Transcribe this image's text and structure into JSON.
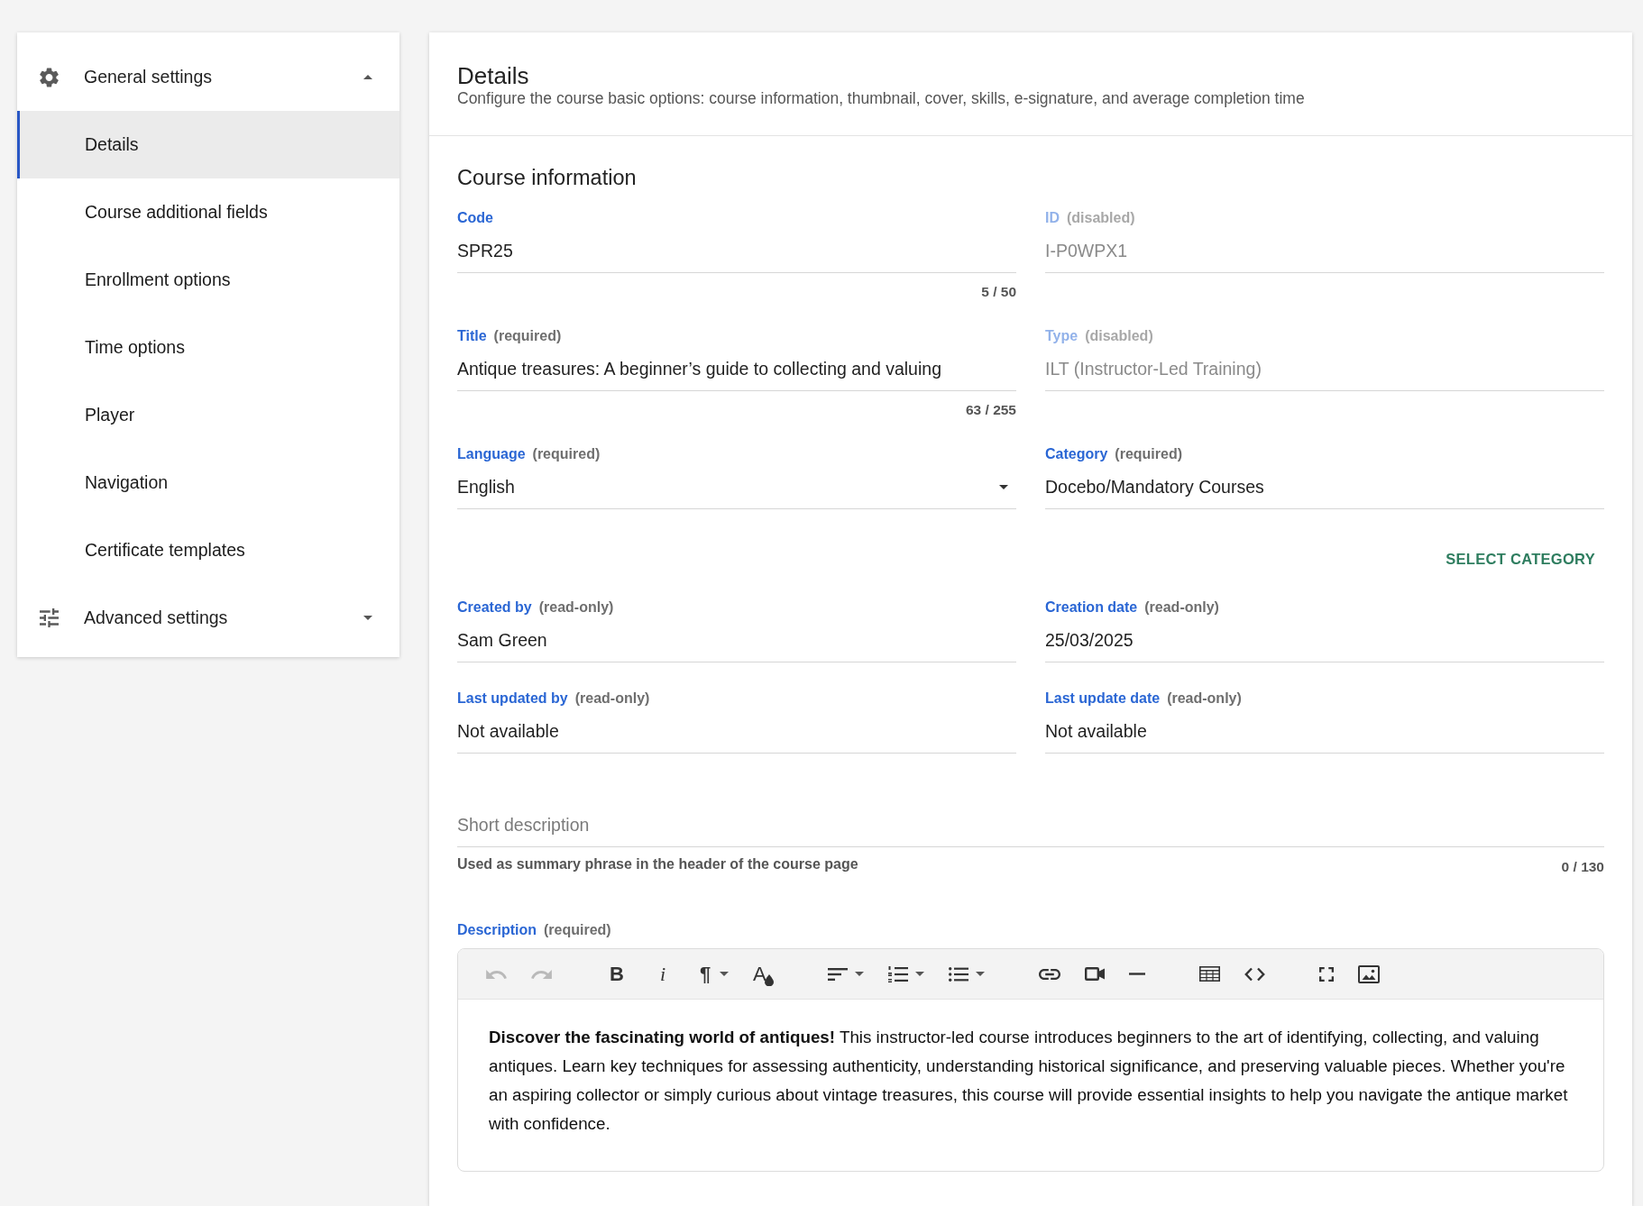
{
  "sidebar": {
    "sections": [
      {
        "label": "General settings",
        "expanded": true,
        "items": [
          {
            "label": "Details",
            "selected": true
          },
          {
            "label": "Course additional fields",
            "selected": false
          },
          {
            "label": "Enrollment options",
            "selected": false
          },
          {
            "label": "Time options",
            "selected": false
          },
          {
            "label": "Player",
            "selected": false
          },
          {
            "label": "Navigation",
            "selected": false
          },
          {
            "label": "Certificate templates",
            "selected": false
          }
        ]
      },
      {
        "label": "Advanced settings",
        "expanded": false
      }
    ]
  },
  "header": {
    "title": "Details",
    "subtitle": "Configure the course basic options: course information, thumbnail, cover, skills, e-signature, and average completion time"
  },
  "course_information": {
    "heading": "Course information",
    "fields": [
      {
        "kind": "text",
        "label": "Code",
        "value": "SPR25",
        "counter": "5 / 50",
        "disabled": false
      },
      {
        "kind": "text",
        "label": "ID",
        "note": "(disabled)",
        "value": "I-P0WPX1",
        "disabled": true
      },
      {
        "kind": "text",
        "label": "Title",
        "note": "(required)",
        "value": "Antique treasures: A beginner’s guide to collecting and valuing",
        "counter": "63 / 255",
        "disabled": false
      },
      {
        "kind": "text",
        "label": "Type",
        "note": "(disabled)",
        "value": "ILT (Instructor-Led Training)",
        "disabled": true
      },
      {
        "kind": "select",
        "label": "Language",
        "note": "(required)",
        "value": "English",
        "disabled": false
      },
      {
        "kind": "text",
        "label": "Category",
        "note": "(required)",
        "value": "Docebo/Mandatory Courses",
        "action": "SELECT CATEGORY",
        "disabled": false
      },
      {
        "kind": "text",
        "label": "Created by",
        "note": "(read-only)",
        "value": "Sam Green",
        "disabled": false
      },
      {
        "kind": "text",
        "label": "Creation date",
        "note": "(read-only)",
        "value": "25/03/2025",
        "disabled": false
      },
      {
        "kind": "text",
        "label": "Last updated by",
        "note": "(read-only)",
        "value": "Not available",
        "disabled": false
      },
      {
        "kind": "text",
        "label": "Last update date",
        "note": "(read-only)",
        "value": "Not available",
        "disabled": false
      }
    ],
    "short_description": {
      "placeholder": "Short description",
      "help": "Used as summary phrase in the header of the course page",
      "counter": "0 / 130"
    },
    "description": {
      "label": "Description",
      "note": "(required)",
      "toolbar": [
        [
          {
            "kind": "undo",
            "disabled": true,
            "dropdown": false
          },
          {
            "kind": "redo",
            "disabled": true,
            "dropdown": false
          }
        ],
        [
          {
            "kind": "bold",
            "glyph": "B",
            "disabled": false,
            "dropdown": false
          },
          {
            "kind": "italic",
            "glyph": "i",
            "disabled": false,
            "dropdown": false
          },
          {
            "kind": "paragraph",
            "glyph": "¶",
            "disabled": false,
            "dropdown": true
          },
          {
            "kind": "text-color",
            "glyph": "A",
            "disabled": false,
            "dropdown": false
          }
        ],
        [
          {
            "kind": "align",
            "disabled": false,
            "dropdown": true
          },
          {
            "kind": "numbered-list",
            "disabled": false,
            "dropdown": true
          },
          {
            "kind": "bulleted-list",
            "disabled": false,
            "dropdown": true
          }
        ],
        [
          {
            "kind": "link",
            "disabled": false,
            "dropdown": false
          },
          {
            "kind": "video",
            "disabled": false,
            "dropdown": false
          },
          {
            "kind": "rule",
            "disabled": false,
            "dropdown": false
          }
        ],
        [
          {
            "kind": "table",
            "disabled": false,
            "dropdown": false
          },
          {
            "kind": "code",
            "disabled": false,
            "dropdown": false
          }
        ],
        [
          {
            "kind": "fullscreen",
            "disabled": false,
            "dropdown": false
          },
          {
            "kind": "image",
            "disabled": false,
            "dropdown": false
          }
        ]
      ],
      "text": "**Discover the fascinating world of antiques!** This instructor-led course introduces beginners to the art of identifying, collecting, and valuing antiques. Learn key techniques for assessing authenticity, understanding historical significance, and preserving valuable pieces. Whether you're an aspiring collector or simply curious about vintage treasures, this course will provide essential insights to help you navigate the antique market with confidence."
    }
  }
}
